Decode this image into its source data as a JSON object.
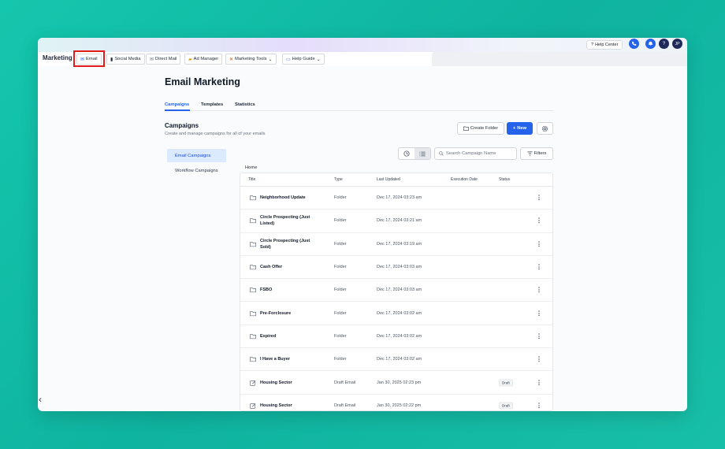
{
  "topbar": {
    "help_center": "Help Center",
    "help_icon_glyph": "?",
    "question_glyph": "?",
    "avatar_initials": "JP"
  },
  "nav": {
    "brand": "Marketing",
    "tabs": [
      {
        "label": "Email",
        "icon": "email-icon",
        "glyph": "✉"
      },
      {
        "label": "Social Media",
        "icon": "phone-icon",
        "glyph": "▮"
      },
      {
        "label": "Direct Mail",
        "icon": "mail-icon",
        "glyph": "✉"
      },
      {
        "label": "Ad Manager",
        "icon": "folder-icon",
        "glyph": "▰"
      },
      {
        "label": "Marketing Tools",
        "icon": "tools-icon",
        "glyph": "✕"
      },
      {
        "label": "Help Guide",
        "icon": "book-icon",
        "glyph": "▭"
      }
    ],
    "highlighted_tab": "Email"
  },
  "page": {
    "title": "Email Marketing",
    "tabs": [
      "Campaigns",
      "Templates",
      "Statistics"
    ],
    "active_tab": "Campaigns",
    "section_title": "Campaigns",
    "section_subtitle": "Create and manage campaigns for all of your emails",
    "create_folder": "Create Folder",
    "new_button": "New",
    "new_plus": "+"
  },
  "sidebar": {
    "items": [
      "Email Campaigns",
      "Workflow Campaigns"
    ],
    "active": "Email Campaigns"
  },
  "toolbar": {
    "search_placeholder": "Search Campaign Name",
    "filters": "Filters"
  },
  "breadcrumb": "Home",
  "table": {
    "columns": [
      "Title",
      "Type",
      "Last Updated",
      "Execution Date",
      "Status"
    ],
    "rows": [
      {
        "title": "Neighborhood Update",
        "type": "Folder",
        "updated": "Dec 17, 2024 03:23 am",
        "status": "",
        "icon": "folder-icon"
      },
      {
        "title": "Circle Prospecting (Just Listed)",
        "type": "Folder",
        "updated": "Dec 17, 2024 03:21 am",
        "status": "",
        "icon": "folder-icon"
      },
      {
        "title": "Circle Prospecting (Just Sold)",
        "type": "Folder",
        "updated": "Dec 17, 2024 03:19 am",
        "status": "",
        "icon": "folder-icon"
      },
      {
        "title": "Cash Offer",
        "type": "Folder",
        "updated": "Dec 17, 2024 03:03 am",
        "status": "",
        "icon": "folder-icon"
      },
      {
        "title": "FSBO",
        "type": "Folder",
        "updated": "Dec 17, 2024 03:03 am",
        "status": "",
        "icon": "folder-icon"
      },
      {
        "title": "Pre-Forclosure",
        "type": "Folder",
        "updated": "Dec 17, 2024 03:02 am",
        "status": "",
        "icon": "folder-icon"
      },
      {
        "title": "Expired",
        "type": "Folder",
        "updated": "Dec 17, 2024 03:02 am",
        "status": "",
        "icon": "folder-icon"
      },
      {
        "title": "I Have a Buyer",
        "type": "Folder",
        "updated": "Dec 17, 2024 03:02 am",
        "status": "",
        "icon": "folder-icon"
      },
      {
        "title": "Housing Sector",
        "type": "Draft Email",
        "updated": "Jan 30, 2025 02:23 pm",
        "status": "Draft",
        "icon": "edit-icon"
      },
      {
        "title": "Housing Sector",
        "type": "Draft Email",
        "updated": "Jan 30, 2025 02:22 pm",
        "status": "Draft",
        "icon": "edit-icon"
      }
    ]
  },
  "colors": {
    "background": "#14c6ad",
    "accent": "#2563eb",
    "highlight": "#e31b1b"
  }
}
